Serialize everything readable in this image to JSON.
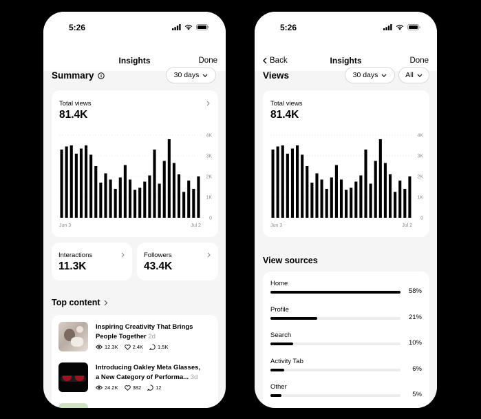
{
  "left": {
    "status": {
      "time": "5:26"
    },
    "nav": {
      "title": "Insights",
      "done": "Done"
    },
    "summary": {
      "title": "Summary",
      "range": "30 days"
    },
    "total_views": {
      "label": "Total views",
      "value": "81.4K"
    },
    "interactions": {
      "label": "Interactions",
      "value": "11.3K"
    },
    "followers": {
      "label": "Followers",
      "value": "43.4K"
    },
    "top_content": {
      "title": "Top content",
      "posts": [
        {
          "title_line1": "Inspiring Creativity That Brings",
          "title_line2": "People Together",
          "age": "2d",
          "views": "12.3K",
          "likes": "2.4K",
          "comments": "1.5K"
        },
        {
          "title_line1": "Introducing Oakley Meta Glasses,",
          "title_line2": "a New Category of Performa...",
          "age": "3d",
          "views": "24.2K",
          "likes": "382",
          "comments": "12"
        }
      ]
    }
  },
  "right": {
    "status": {
      "time": "5:26"
    },
    "nav": {
      "back": "Back",
      "title": "Insights",
      "done": "Done"
    },
    "views": {
      "title": "Views",
      "range": "30 days",
      "filter": "All"
    },
    "total_views": {
      "label": "Total views",
      "value": "81.4K"
    },
    "view_sources": {
      "title": "View sources",
      "items": [
        {
          "label": "Home",
          "pct_label": "58%",
          "pct": 0.58
        },
        {
          "label": "Profile",
          "pct_label": "21%",
          "pct": 0.21
        },
        {
          "label": "Search",
          "pct_label": "10%",
          "pct": 0.1
        },
        {
          "label": "Activity Tab",
          "pct_label": "6%",
          "pct": 0.06
        },
        {
          "label": "Other",
          "pct_label": "5%",
          "pct": 0.05
        }
      ]
    }
  },
  "colors": {
    "accent": "#000000",
    "track": "#ececec",
    "muted": "#8a8a8a"
  },
  "icons": [
    "info-icon",
    "chevron-down-icon",
    "chevron-right-icon",
    "chevron-left-icon",
    "eye-icon",
    "heart-icon",
    "comment-icon",
    "signal-icon",
    "wifi-icon",
    "battery-icon"
  ],
  "chart_data": [
    {
      "type": "bar",
      "x_start": "Jun 3",
      "x_end": "Jul 2",
      "values": [
        3300,
        3450,
        3500,
        3100,
        3350,
        3500,
        3050,
        2500,
        1700,
        2150,
        1850,
        1400,
        1950,
        2550,
        1850,
        1350,
        1450,
        1750,
        2050,
        3300,
        1650,
        2750,
        3800,
        2650,
        2100,
        1250,
        1800,
        1400,
        2000
      ],
      "yticks": [
        "4K",
        "3K",
        "2K",
        "1K",
        "0"
      ],
      "ylim": [
        0,
        4000
      ]
    },
    {
      "type": "bar",
      "x_start": "Jun 3",
      "x_end": "Jul 2",
      "values": [
        3300,
        3450,
        3500,
        3100,
        3350,
        3500,
        3050,
        2500,
        1700,
        2150,
        1850,
        1400,
        1950,
        2550,
        1850,
        1350,
        1450,
        1750,
        2050,
        3300,
        1650,
        2750,
        3800,
        2650,
        2100,
        1250,
        1800,
        1400,
        2000
      ],
      "yticks": [
        "4K",
        "3K",
        "2K",
        "1K",
        "0"
      ],
      "ylim": [
        0,
        4000
      ]
    }
  ]
}
